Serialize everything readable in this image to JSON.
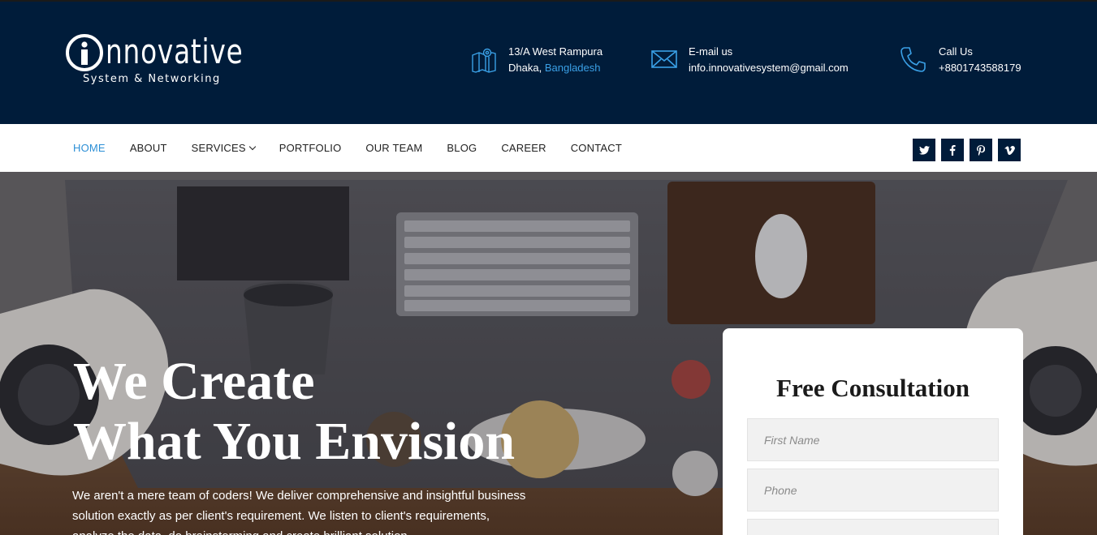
{
  "brand": {
    "wordmark": "nnovative",
    "tagline": "System & Networking"
  },
  "contact": {
    "address_line1": "13/A West Rampura",
    "address_city": "Dhaka,",
    "address_country": "Bangladesh",
    "email_label": "E-mail us",
    "email_value": "info.innovativesystem@gmail.com",
    "phone_label": "Call Us",
    "phone_value": "+8801743588179"
  },
  "nav": {
    "items": [
      {
        "label": "HOME",
        "active": true
      },
      {
        "label": "ABOUT"
      },
      {
        "label": "SERVICES",
        "has_dropdown": true
      },
      {
        "label": "PORTFOLIO"
      },
      {
        "label": "OUR TEAM"
      },
      {
        "label": "BLOG"
      },
      {
        "label": "CAREER"
      },
      {
        "label": "CONTACT"
      }
    ]
  },
  "social": [
    {
      "icon": "twitter-icon",
      "glyph": "🐦"
    },
    {
      "icon": "facebook-icon",
      "glyph": "f"
    },
    {
      "icon": "pinterest-icon",
      "glyph": "p"
    },
    {
      "icon": "vimeo-icon",
      "glyph": "v"
    }
  ],
  "hero": {
    "headline_line1": "We Create",
    "headline_line2": "What You Envision",
    "lead": "We aren't a mere team of coders! We deliver comprehensive and insightful business solution exactly as per client's requirement. We listen to client's requirements, analyze the data, do brainstorming and create brilliant solution."
  },
  "consultation": {
    "title": "Free Consultation",
    "first_name_placeholder": "First Name",
    "phone_placeholder": "Phone"
  },
  "colors": {
    "header_bg": "#001c3a",
    "accent": "#3aa0e6",
    "active_nav": "#2c8fd6"
  }
}
